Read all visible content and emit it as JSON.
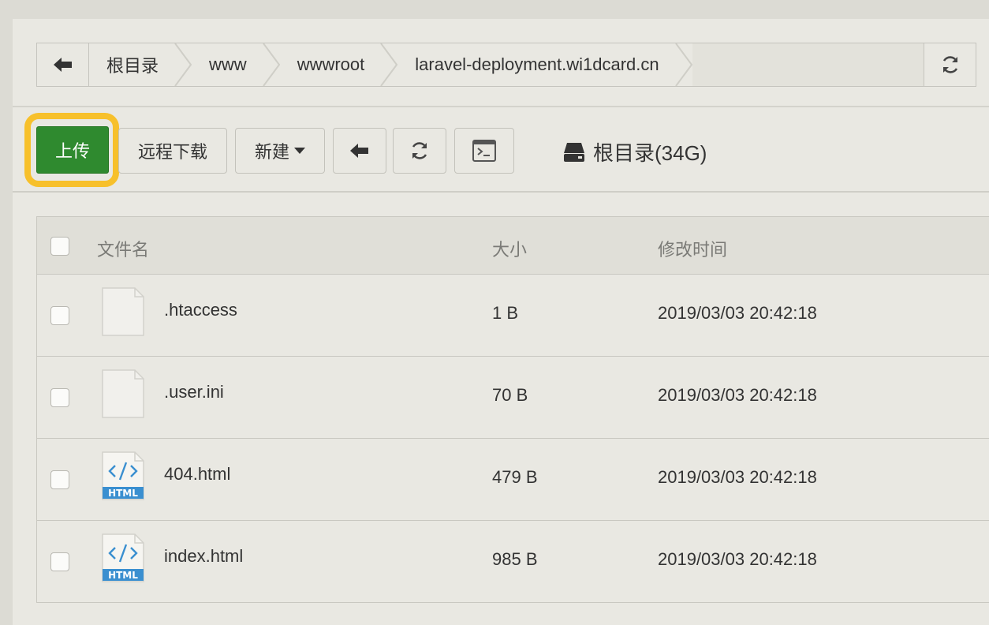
{
  "breadcrumb": {
    "items": [
      "根目录",
      "www",
      "wwwroot",
      "laravel-deployment.wi1dcard.cn"
    ]
  },
  "toolbar": {
    "upload_label": "上传",
    "remote_download_label": "远程下载",
    "new_label": "新建",
    "disk_label": "根目录(34G)"
  },
  "table": {
    "headers": {
      "name": "文件名",
      "size": "大小",
      "modified": "修改时间"
    },
    "rows": [
      {
        "name": ".htaccess",
        "size": "1 B",
        "modified": "2019/03/03 20:42:18",
        "icon": "blank-file-icon"
      },
      {
        "name": ".user.ini",
        "size": "70 B",
        "modified": "2019/03/03 20:42:18",
        "icon": "blank-file-icon"
      },
      {
        "name": "404.html",
        "size": "479 B",
        "modified": "2019/03/03 20:42:18",
        "icon": "html-file-icon"
      },
      {
        "name": "index.html",
        "size": "985 B",
        "modified": "2019/03/03 20:42:18",
        "icon": "html-file-icon"
      }
    ],
    "html_badge": "HTML"
  },
  "colors": {
    "upload_green": "#2f8a2f",
    "highlight_yellow": "#f7c02b",
    "html_blue": "#3a8fd0"
  }
}
